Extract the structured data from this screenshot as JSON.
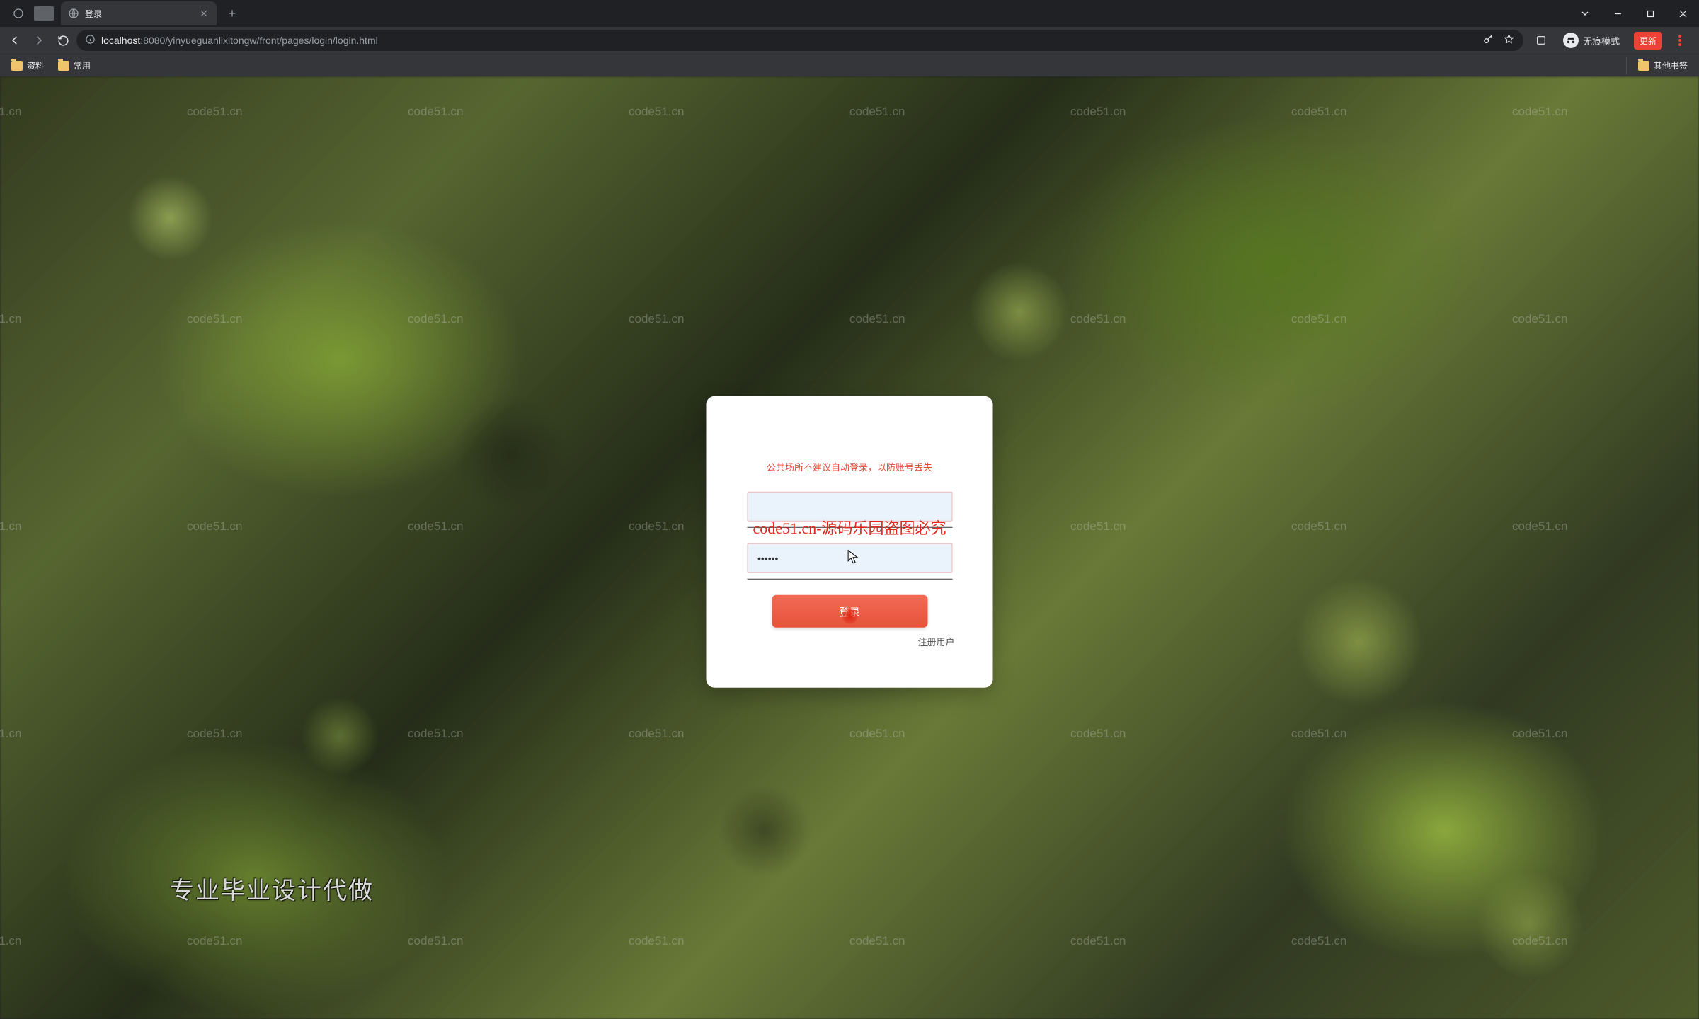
{
  "browser": {
    "tab_title": "登录",
    "url_host": "localhost",
    "url_port": ":8080",
    "url_path": "/yinyueguanlixitongw/front/pages/login/login.html",
    "incognito_label": "无痕模式",
    "update_label": "更新"
  },
  "bookmarks": {
    "items": [
      "资料",
      "常用"
    ],
    "other": "其他书签"
  },
  "page": {
    "watermark_text": "code51.cn",
    "caption": "专业毕业设计代做",
    "overlay": "code51.cn-源码乐园盗图必究"
  },
  "login": {
    "warning": "公共场所不建议自动登录，以防账号丢失",
    "username_value": "",
    "username_placeholder": "",
    "password_value": "••••••",
    "password_placeholder": "",
    "submit_label": "登录",
    "register_label": "注册用户"
  }
}
